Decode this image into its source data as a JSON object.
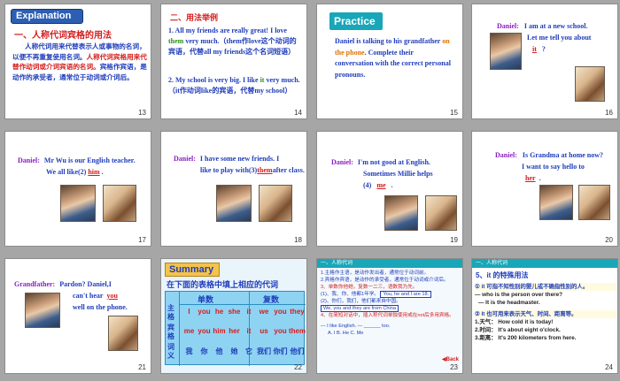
{
  "colors": {
    "accent_blue": "#1f3dbb",
    "accent_red": "#d21e1e",
    "teal_bar": "#18a6b8",
    "summary_bg": "#f4c34a"
  },
  "slides": {
    "s13": {
      "num": "13",
      "tag": "Explanation",
      "heading": "一、人称代词宾格的用法",
      "body_1": "人称代词用来代替表示人或事物的名词，以便不再重复使用名词。",
      "body_2": "人称代词宾格用来代替作动词或介词宾语的名词。",
      "body_3": "宾格作宾语，是动作的承受者，通常位于动词或介词后。"
    },
    "s14": {
      "num": "14",
      "heading": "二、用法举例",
      "item1_a": "1. All my friends are really great! I love ",
      "item1_b": "them",
      "item1_c": " very much.（them作love这个动词的宾语，代替all my friends这个名词短语）",
      "item2_a": "2. My school is very big. I like ",
      "item2_b": "it",
      "item2_c": " very much.（it作动词like的宾语，代替my school）"
    },
    "s15": {
      "num": "15",
      "tag": "Practice",
      "line_a": "Daniel is talking to his grandfather ",
      "line_b": "on the phone",
      "line_c": ". Complete their conversation with the correct personal pronouns."
    },
    "s16": {
      "num": "16",
      "speaker": "Daniel:",
      "line1": "I am at a new school.",
      "line2": "Let me tell you about",
      "blank": "it",
      "end": "?"
    },
    "s17": {
      "num": "17",
      "speaker": "Daniel:",
      "line1": "Mr Wu is our English teacher.",
      "line2": "We all like(2)",
      "blank": "him",
      "end": "."
    },
    "s18": {
      "num": "18",
      "speaker": "Daniel:",
      "line1": "I have some new friends. I",
      "line2": "like to play with(3)",
      "blank": "them",
      "line3": "after class."
    },
    "s19": {
      "num": "19",
      "speaker": "Daniel:",
      "line1": "I'm not good at English.",
      "line2": "Sometimes Millie helps",
      "line3": "(4)",
      "blank": "me",
      "end": "."
    },
    "s20": {
      "num": "20",
      "speaker": "Daniel:",
      "line1": "Is Grandma at home now?",
      "line2": "I want to say hello to",
      "blank": "her",
      "end": "."
    },
    "s21": {
      "num": "21",
      "speaker": "Grandfather:",
      "line1": "Pardon? Daniel,I",
      "line2": "can't hear",
      "blank": "you",
      "line3": "well on the phone."
    },
    "s22": {
      "num": "22",
      "tag": "Summary",
      "instruction": "在下面的表格中填上相应的代词",
      "col_singular": "单数",
      "col_plural": "复数",
      "row_label_1": "主格",
      "row_label_2": "宾格",
      "row_label_3": "词义",
      "subject": [
        "I",
        "you",
        "he",
        "she",
        "it",
        "we",
        "you",
        "they"
      ],
      "object": [
        "me",
        "you",
        "him",
        "her",
        "it",
        "us",
        "you",
        "them"
      ],
      "meaning": [
        "我",
        "你",
        "他",
        "她",
        "它",
        "我们",
        "你们",
        "他们"
      ]
    },
    "s23": {
      "num": "23",
      "tag": "一、人称代词",
      "l1": "1.主格作主语，是动作发出者，通常位于动词前。",
      "l2": "2.宾格作宾语，是动作的承受者，通常位于动词或介词后。",
      "l3": "3、单数你他她，复数一二三，语数我为先。",
      "l4a": "(1)、我、你、他都1年学。",
      "l4b": "You, he and I are 18.",
      "l5": "(2)、你们，我们，他们都来自中国。",
      "l6": "We, you and they are from China",
      "l7": "4、在简短对话中，插入称代词单独使用或在not后多用宾格。",
      "q": "— I like English.       — ______ too.",
      "opts": "A. I      B. He      C. Me",
      "back": "Back"
    },
    "s24": {
      "num": "24",
      "tag": "一、人称代词",
      "heading": "5、it 的特殊用法",
      "p1_title": "① it 可指不知性别的婴儿或不确指性别的人。",
      "p1_a": "— who is the person over there?",
      "p1_b": "— It is the headmaster.",
      "p2_title": "② It 也可用来表示天气、时间、距离等。",
      "e1_label": "1.天气：",
      "e1": "How cold it is today!",
      "e2_label": "2.时间：",
      "e2": "It's about eight o'clock.",
      "e3_label": "3.距离：",
      "e3": "It's 200 kilometers from here."
    }
  }
}
